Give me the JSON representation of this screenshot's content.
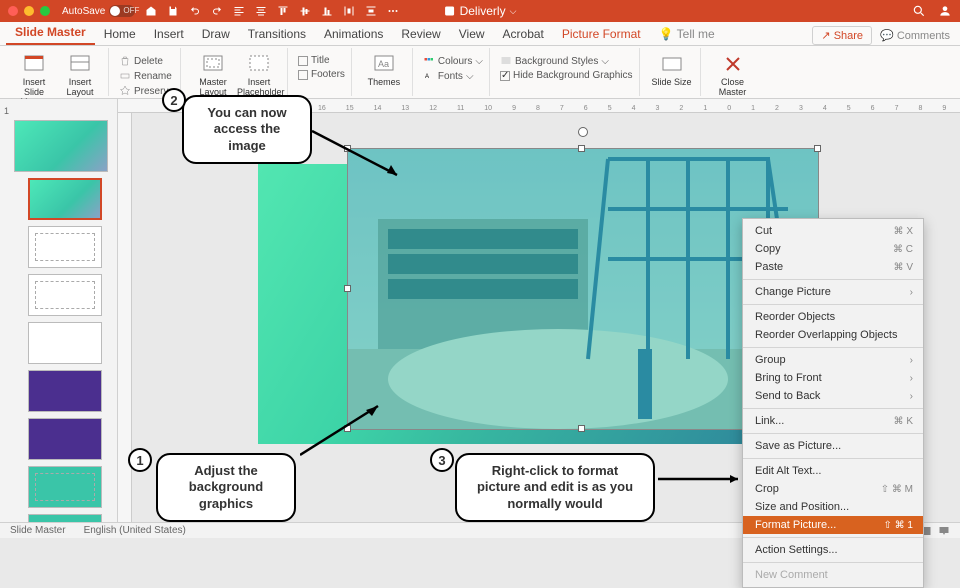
{
  "titlebar": {
    "autosave_label": "AutoSave",
    "autosave_state": "OFF",
    "doc_title": "Deliverly"
  },
  "tabs": {
    "items": [
      "Slide Master",
      "Home",
      "Insert",
      "Draw",
      "Transitions",
      "Animations",
      "Review",
      "View",
      "Acrobat",
      "Picture Format"
    ],
    "tellme": "Tell me",
    "share": "Share",
    "comments": "Comments"
  },
  "ribbon": {
    "insert_slide_master": "Insert Slide Master",
    "insert_layout": "Insert Layout",
    "delete": "Delete",
    "rename": "Rename",
    "preserve": "Preserve",
    "master_layout": "Master Layout",
    "insert_placeholder": "Insert Placeholder",
    "title": "Title",
    "footers": "Footers",
    "themes": "Themes",
    "colours": "Colours",
    "fonts": "Fonts",
    "bg_styles": "Background Styles",
    "hide_bg": "Hide Background Graphics",
    "slide_size": "Slide Size",
    "close_master": "Close Master"
  },
  "ruler_marks": [
    "16",
    "15",
    "14",
    "13",
    "12",
    "11",
    "10",
    "9",
    "8",
    "7",
    "6",
    "5",
    "4",
    "3",
    "2",
    "1",
    "0",
    "1",
    "2",
    "3",
    "4",
    "5",
    "6",
    "7",
    "8",
    "9",
    "10",
    "11",
    "12",
    "13",
    "14",
    "15",
    "16"
  ],
  "context_menu": {
    "cut": "Cut",
    "cut_k": "⌘ X",
    "copy": "Copy",
    "copy_k": "⌘ C",
    "paste": "Paste",
    "paste_k": "⌘ V",
    "change_picture": "Change Picture",
    "reorder": "Reorder Objects",
    "reorder_ov": "Reorder Overlapping Objects",
    "group": "Group",
    "bring_front": "Bring to Front",
    "send_back": "Send to Back",
    "link": "Link...",
    "link_k": "⌘ K",
    "save_as_pic": "Save as Picture...",
    "edit_alt": "Edit Alt Text...",
    "crop": "Crop",
    "crop_k": "⇧ ⌘ M",
    "size_pos": "Size and Position...",
    "format_pic": "Format Picture...",
    "format_pic_k": "⇧ ⌘ 1",
    "action": "Action Settings...",
    "new_comment": "New Comment"
  },
  "annotations": {
    "n1": "1",
    "t1": "Adjust the background graphics",
    "n2": "2",
    "t2": "You can now access the image",
    "n3": "3",
    "t3": "Right-click to format picture and edit is as you normally would"
  },
  "status": {
    "view": "Slide Master",
    "lang": "English (United States)"
  }
}
